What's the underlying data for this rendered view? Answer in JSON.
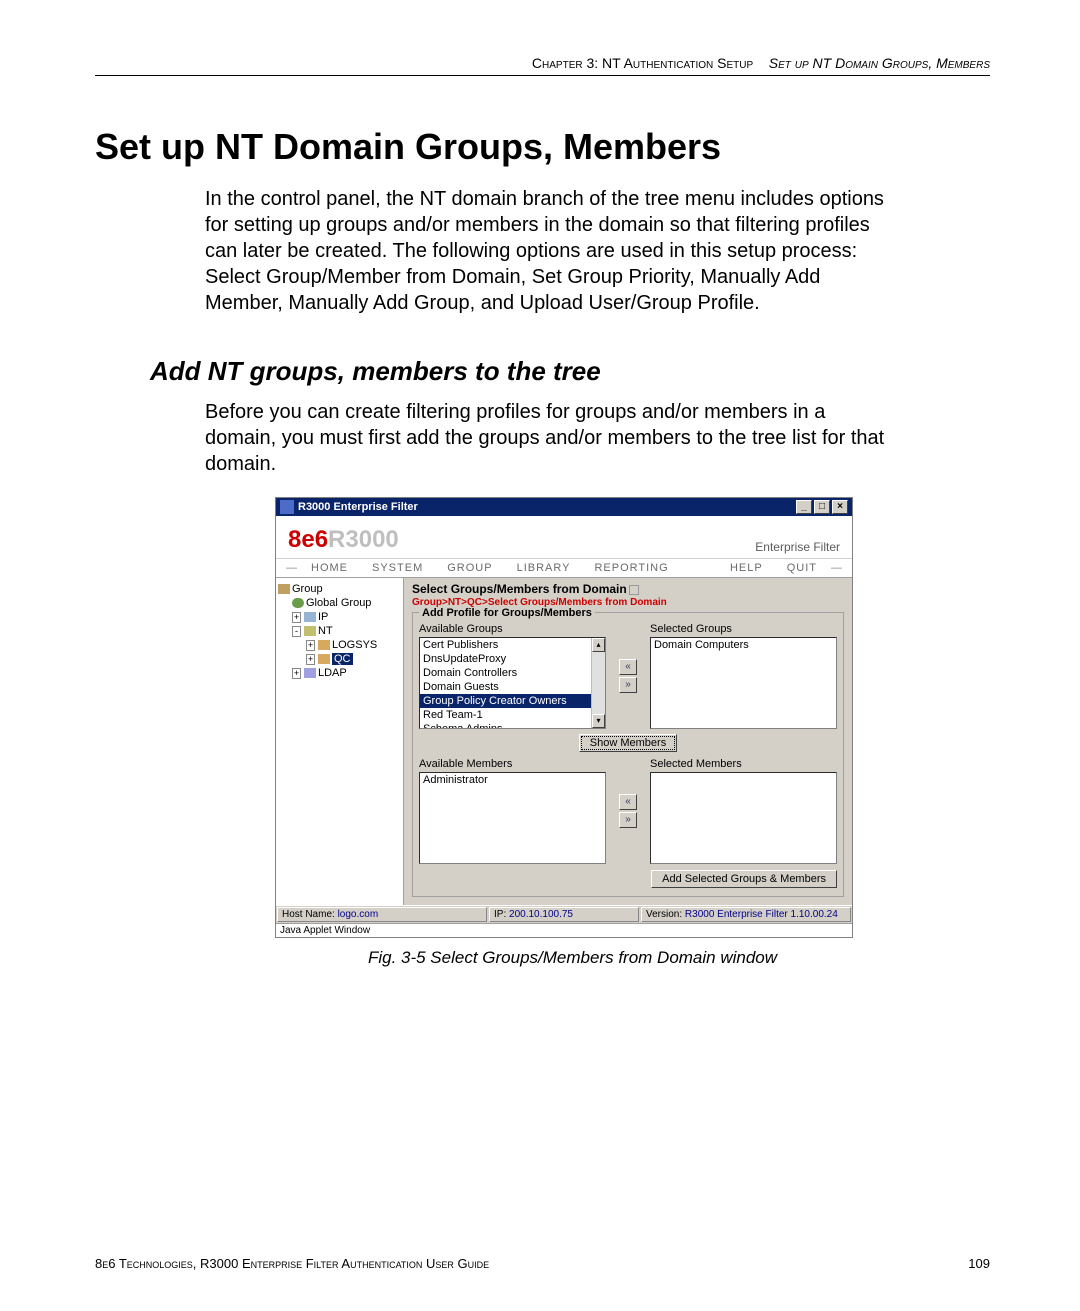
{
  "chapterHeader": {
    "left": "Chapter 3: NT Authentication Setup",
    "right": "Set up NT Domain Groups, Members"
  },
  "title": "Set up NT Domain Groups, Members",
  "intro": "In the control panel, the NT domain branch of the tree menu includes options for setting up groups and/or members in the domain so that filtering profiles can later be created. The following options are used in this setup process: Select Group/Member from Domain, Set Group Priority, Manually Add Member, Manually Add Group, and Upload User/Group Profile.",
  "subhead": "Add NT groups, members to the tree",
  "subIntro": "Before you can create filtering profiles for groups and/or members in a domain, you must first add the groups and/or members to the tree list for that domain.",
  "screenshot": {
    "windowTitle": "R3000 Enterprise Filter",
    "windowButtons": {
      "min": "_",
      "max": "□",
      "close": "×"
    },
    "logoAccent": "8e6",
    "logoRest": "R3000",
    "brand": "Enterprise Filter",
    "menu": [
      "HOME",
      "SYSTEM",
      "GROUP",
      "LIBRARY",
      "REPORTING",
      "HELP",
      "QUIT"
    ],
    "tree": {
      "root": "Group",
      "items": [
        {
          "label": "Global Group",
          "indent": 1,
          "icon": "ic-globe",
          "expander": ""
        },
        {
          "label": "IP",
          "indent": 1,
          "icon": "ic-ip",
          "expander": "+"
        },
        {
          "label": "NT",
          "indent": 1,
          "icon": "ic-nt",
          "expander": "-"
        },
        {
          "label": "LOGSYS",
          "indent": 2,
          "icon": "ic-sub",
          "expander": "+"
        },
        {
          "label": "QC",
          "indent": 2,
          "icon": "ic-sub",
          "expander": "+",
          "selected": true
        },
        {
          "label": "LDAP",
          "indent": 1,
          "icon": "ic-ldap",
          "expander": "+"
        }
      ]
    },
    "mainTitle": "Select Groups/Members from Domain",
    "breadcrumb": "Group>NT>QC>Select Groups/Members from Domain",
    "fieldsetLegend": "Add Profile for Groups/Members",
    "availableGroupsLabel": "Available Groups",
    "availableGroups": [
      "Cert Publishers",
      "DnsUpdateProxy",
      "Domain Controllers",
      "Domain Guests",
      "Group Policy Creator Owners",
      "Red Team-1",
      "Schema Admins"
    ],
    "availableGroupsSelectedIndex": 4,
    "selectedGroupsLabel": "Selected Groups",
    "selectedGroups": [
      "Domain Computers"
    ],
    "showMembersButton": "Show Members",
    "availableMembersLabel": "Available Members",
    "availableMembers": [
      "Administrator"
    ],
    "selectedMembersLabel": "Selected Members",
    "selectedMembers": [],
    "addButton": "Add Selected Groups & Members",
    "status": {
      "hostKey": "Host Name:",
      "hostVal": "logo.com",
      "ipKey": "IP:",
      "ipVal": "200.10.100.75",
      "verKey": "Version:",
      "verVal": "R3000 Enterprise Filter 1.10.00.24"
    },
    "appletMsg": "Java Applet Window"
  },
  "figCaption": "Fig. 3-5  Select Groups/Members from Domain window",
  "footer": {
    "left": "8e6 Technologies, R3000 Enterprise Filter Authentication User Guide",
    "page": "109"
  }
}
